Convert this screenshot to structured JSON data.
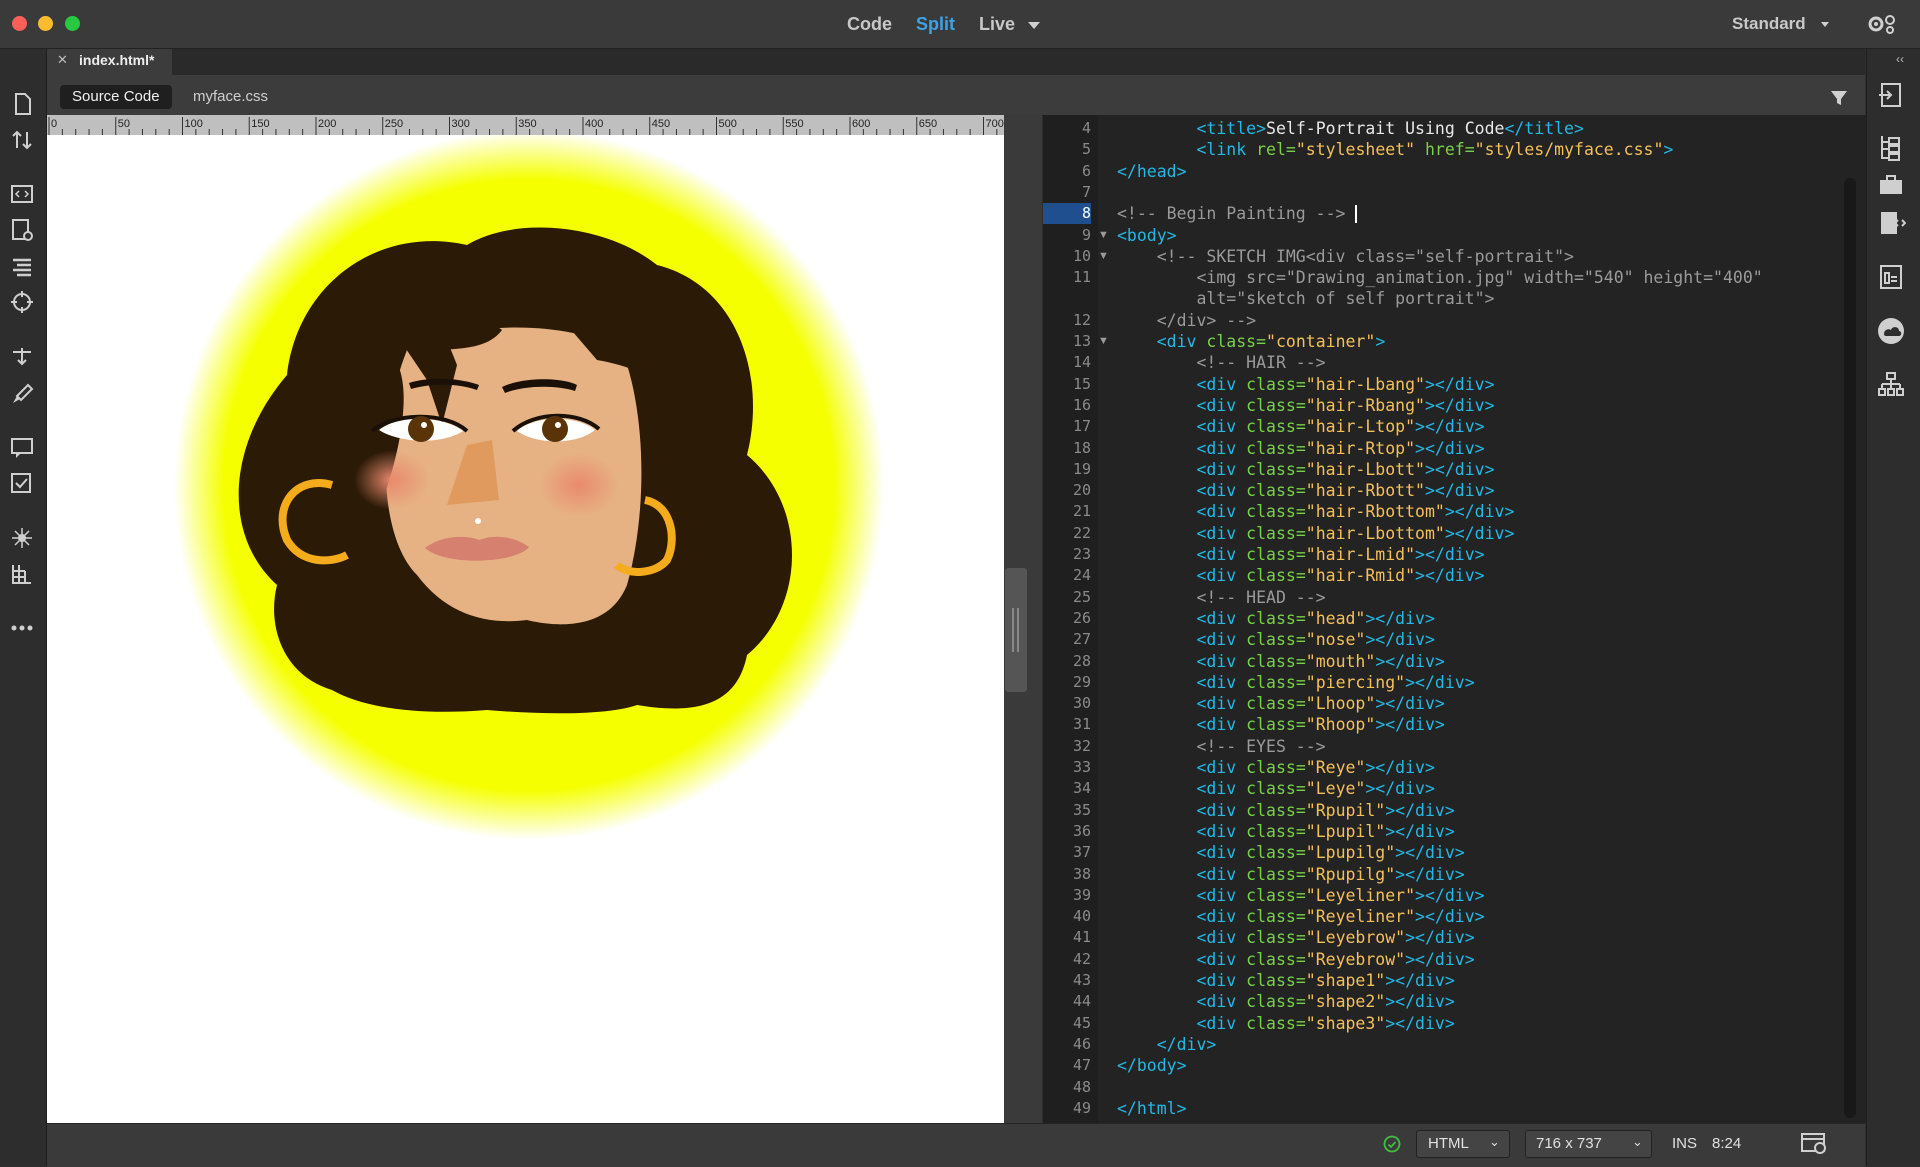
{
  "titlebar": {
    "view_tabs": [
      "Code",
      "Split",
      "Live"
    ],
    "workspace": "Standard"
  },
  "document_tab": {
    "label": "index.html*"
  },
  "sub_tabs": [
    "Source Code",
    "myface.css"
  ],
  "ruler": {
    "ticks": [
      "0",
      "50",
      "100",
      "150",
      "200",
      "250",
      "300",
      "350",
      "400",
      "450",
      "500",
      "550",
      "600",
      "650",
      "700"
    ]
  },
  "code": {
    "line_numbers": [
      "4",
      "5",
      "6",
      "7",
      "8",
      "9",
      "10",
      "11",
      "",
      "12",
      "13",
      "14",
      "15",
      "16",
      "17",
      "18",
      "19",
      "20",
      "21",
      "22",
      "23",
      "24",
      "25",
      "26",
      "27",
      "28",
      "29",
      "30",
      "31",
      "32",
      "33",
      "34",
      "35",
      "36",
      "37",
      "38",
      "39",
      "40",
      "41",
      "42",
      "43",
      "44",
      "45",
      "46",
      "47",
      "48",
      "49"
    ],
    "current_line": "8"
  },
  "statusbar": {
    "language": "HTML",
    "size": "716 x 737",
    "mode": "INS",
    "position": "8:24"
  },
  "colors": {
    "accent": "#3ea2e8",
    "tag": "#24b8e5",
    "attr": "#79d14a",
    "value": "#f3c05a",
    "comment": "#9a9a9a",
    "glow": "#f5ff00",
    "hair": "#2a1a06",
    "skin": "#e7b283"
  }
}
